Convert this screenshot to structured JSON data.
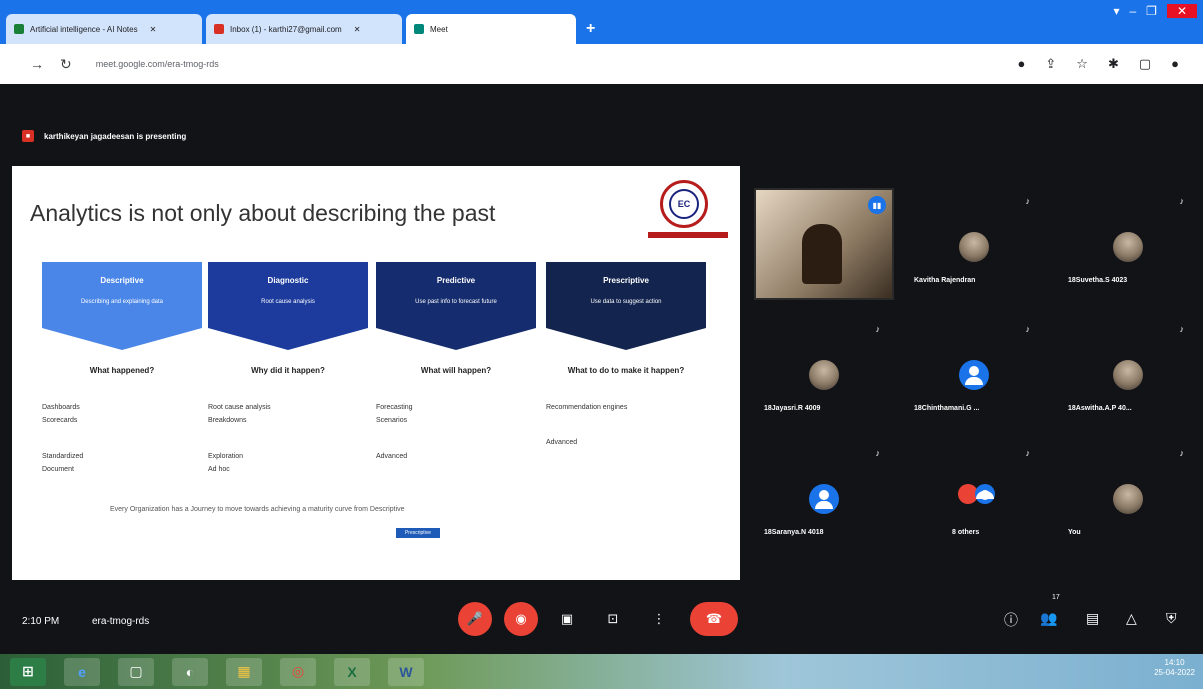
{
  "browser": {
    "tabs": [
      {
        "title": "Artificial intelligence - AI Notes",
        "active": false
      },
      {
        "title": "Inbox (1) - karthi27@gmail.com",
        "active": false
      },
      {
        "title": "Meet",
        "active": true
      }
    ],
    "url": "meet.google.com/era-tmog-rds"
  },
  "meet": {
    "presenting_text": "karthikeyan jagadeesan is presenting",
    "slide": {
      "title": "Analytics is not only about describing the past",
      "columns": [
        {
          "heading": "Descriptive",
          "sub": "Describing and explaining data",
          "question": "What happened?",
          "items": [
            "Dashboards",
            "Scorecards",
            "Standardized",
            "Document"
          ],
          "color": "#4a86e8"
        },
        {
          "heading": "Diagnostic",
          "sub": "Root cause analysis",
          "question": "Why did it happen?",
          "items": [
            "Root cause analysis",
            "Breakdowns",
            "Exploration",
            "Ad hoc"
          ],
          "color": "#1c3b9c"
        },
        {
          "heading": "Predictive",
          "sub": "Use past info to forecast future",
          "question": "What will happen?",
          "items": [
            "Forecasting",
            "Scenarios",
            "Advanced",
            ""
          ],
          "color": "#152c6e"
        },
        {
          "heading": "Prescriptive",
          "sub": "Use data to suggest action",
          "question": "What to do to make it happen?",
          "items": [
            "Recommendation engines",
            "",
            "Advanced",
            ""
          ],
          "color": "#13244f"
        }
      ],
      "footer": "Every Organization has a Journey to move towards achieving a maturity curve from Descriptive",
      "button_label": "Prescriptive"
    },
    "participants": [
      {
        "name": "Kavitha Rajendran",
        "avatar": "photo"
      },
      {
        "name": "18Suvetha.S 4023",
        "avatar": "photo"
      },
      {
        "name": "18Jayasri.R 4009",
        "avatar": "photo"
      },
      {
        "name": "18Chinthamani.G ...",
        "avatar": "default"
      },
      {
        "name": "18Aswitha.A.P 40...",
        "avatar": "photo"
      },
      {
        "name": "18Saranya.N 4018",
        "avatar": "default"
      },
      {
        "name": "8 others",
        "avatar": "group"
      },
      {
        "name": "You",
        "avatar": "photo"
      }
    ],
    "time": "2:10 PM",
    "meeting_code": "era-tmog-rds",
    "people_count": "17"
  },
  "taskbar": {
    "clock_time": "14:10",
    "clock_date": "25-04-2022"
  }
}
